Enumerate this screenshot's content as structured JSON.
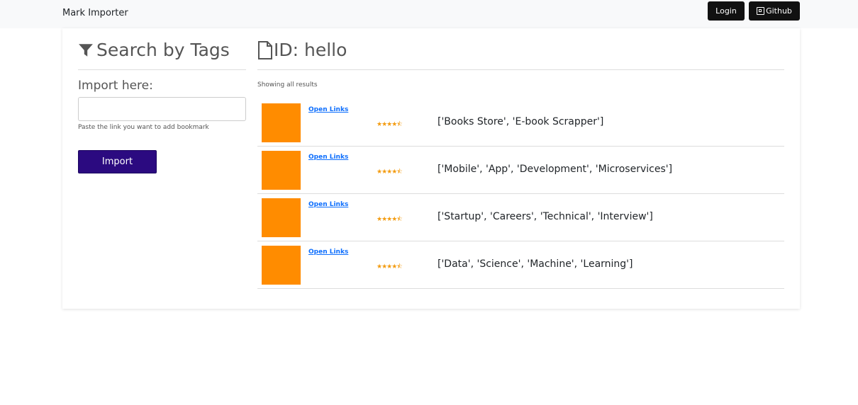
{
  "navbar": {
    "brand": "Mark Importer",
    "login_label": "Login",
    "github_label": "Github"
  },
  "sidebar": {
    "title": "Search by Tags",
    "title_icon": "filter-icon",
    "import_label": "Import here:",
    "input_value": "",
    "input_placeholder": "",
    "help_text": "Paste the link you want to add bookmark",
    "import_button": "Import"
  },
  "main": {
    "title": "ID: hello",
    "title_icon": "file-icon",
    "showing_text": "Showing all results",
    "items": [
      {
        "link_label": "Open Links",
        "rating": "★★★★⯪",
        "tags": "['Books Store', 'E-book Scrapper']"
      },
      {
        "link_label": "Open Links",
        "rating": "★★★★⯪",
        "tags": "['Mobile', 'App', 'Development', 'Microservices']"
      },
      {
        "link_label": "Open Links",
        "rating": "★★★★⯪",
        "tags": "['Startup', 'Careers', 'Technical', 'Interview']"
      },
      {
        "link_label": "Open Links",
        "rating": "★★★★⯪",
        "tags": "['Data', 'Science', 'Machine', 'Learning']"
      }
    ]
  },
  "colors": {
    "accent_button": "#2b0a80",
    "thumbnail": "#ff8c00",
    "star": "#f39c12",
    "link": "#0d6efd"
  }
}
